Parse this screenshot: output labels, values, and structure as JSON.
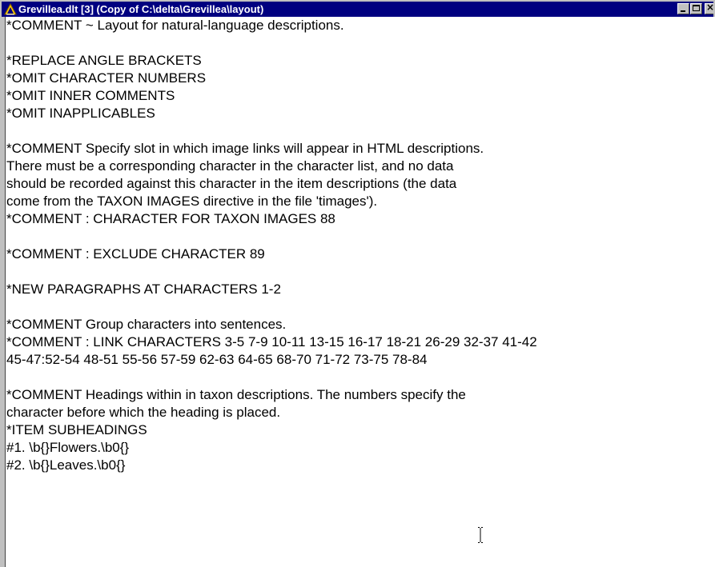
{
  "window": {
    "title": "Grevillea.dlt [3] (Copy of C:\\delta\\Grevillea\\layout)",
    "icon": "delta-app-icon",
    "controls": {
      "minimize": "minimize-icon",
      "maximize": "maximize-icon",
      "close": "close-icon"
    }
  },
  "editor": {
    "lines": [
      "*COMMENT ~ Layout for natural-language descriptions.",
      "",
      "*REPLACE ANGLE BRACKETS",
      "*OMIT CHARACTER NUMBERS",
      "*OMIT INNER COMMENTS",
      "*OMIT INAPPLICABLES",
      "",
      "*COMMENT Specify slot in which image links will appear in HTML descriptions.",
      "There must be a corresponding character in the character list, and no data",
      "should be recorded against this character in the item descriptions (the data",
      "come from the TAXON IMAGES directive in the file 'timages').",
      "*COMMENT : CHARACTER FOR TAXON IMAGES 88",
      "",
      "*COMMENT : EXCLUDE CHARACTER 89",
      "",
      "*NEW PARAGRAPHS AT CHARACTERS 1-2",
      "",
      "*COMMENT Group characters into sentences.",
      "*COMMENT : LINK CHARACTERS 3-5 7-9 10-11 13-15 16-17 18-21 26-29 32-37 41-42",
      "45-47:52-54 48-51 55-56 57-59 62-63 64-65 68-70 71-72 73-75 78-84",
      "",
      "*COMMENT Headings within in taxon descriptions. The numbers specify the",
      "character before which the heading is placed.",
      "*ITEM SUBHEADINGS",
      "#1. \\b{}Flowers.\\b0{}",
      "#2. \\b{}Leaves.\\b0{}"
    ],
    "cursor": "text-cursor-ibeam-icon"
  },
  "colors": {
    "titlebar_bg": "#000080",
    "titlebar_text": "#ffffff",
    "chrome": "#c0c0c0",
    "text": "#000000",
    "background": "#ffffff"
  }
}
